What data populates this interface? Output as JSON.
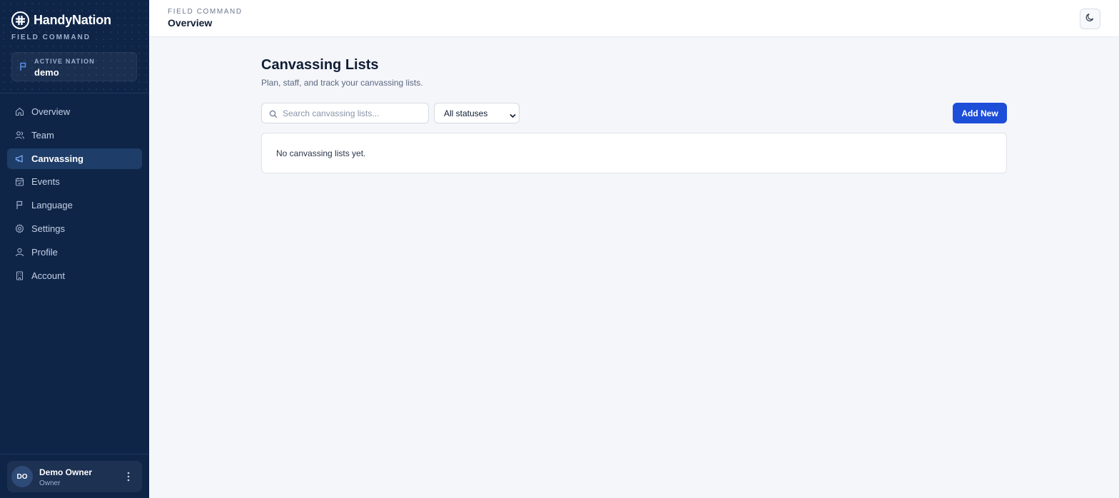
{
  "sidebar": {
    "brand_name": "HandyNation",
    "brand_subtitle": "FIELD COMMAND",
    "nation": {
      "label": "ACTIVE NATION",
      "value": "demo"
    },
    "nav_items": [
      {
        "label": "Overview",
        "icon": "home-icon",
        "active": false
      },
      {
        "label": "Team",
        "icon": "users-icon",
        "active": false
      },
      {
        "label": "Canvassing",
        "icon": "megaphone-icon",
        "active": true
      },
      {
        "label": "Events",
        "icon": "calendar-icon",
        "active": false
      },
      {
        "label": "Language",
        "icon": "flag-icon",
        "active": false
      },
      {
        "label": "Settings",
        "icon": "gear-icon",
        "active": false
      },
      {
        "label": "Profile",
        "icon": "user-icon",
        "active": false
      },
      {
        "label": "Account",
        "icon": "building-icon",
        "active": false
      }
    ],
    "user": {
      "initials": "DO",
      "name": "Demo Owner",
      "role": "Owner"
    }
  },
  "header": {
    "kicker": "FIELD COMMAND",
    "title": "Overview",
    "theme_toggle_icon": "moon-icon"
  },
  "main": {
    "title": "Canvassing Lists",
    "subtitle": "Plan, staff, and track your canvassing lists.",
    "search": {
      "placeholder": "Search canvassing lists...",
      "value": ""
    },
    "status_filter": {
      "selected": "All statuses"
    },
    "add_button_label": "Add New",
    "empty_message": "No canvassing lists yet."
  },
  "colors": {
    "sidebar_bg": "#0f2548",
    "accent": "#1d4ed8",
    "active_nav_bg": "#1e3d68",
    "page_bg": "#f5f6fa"
  }
}
